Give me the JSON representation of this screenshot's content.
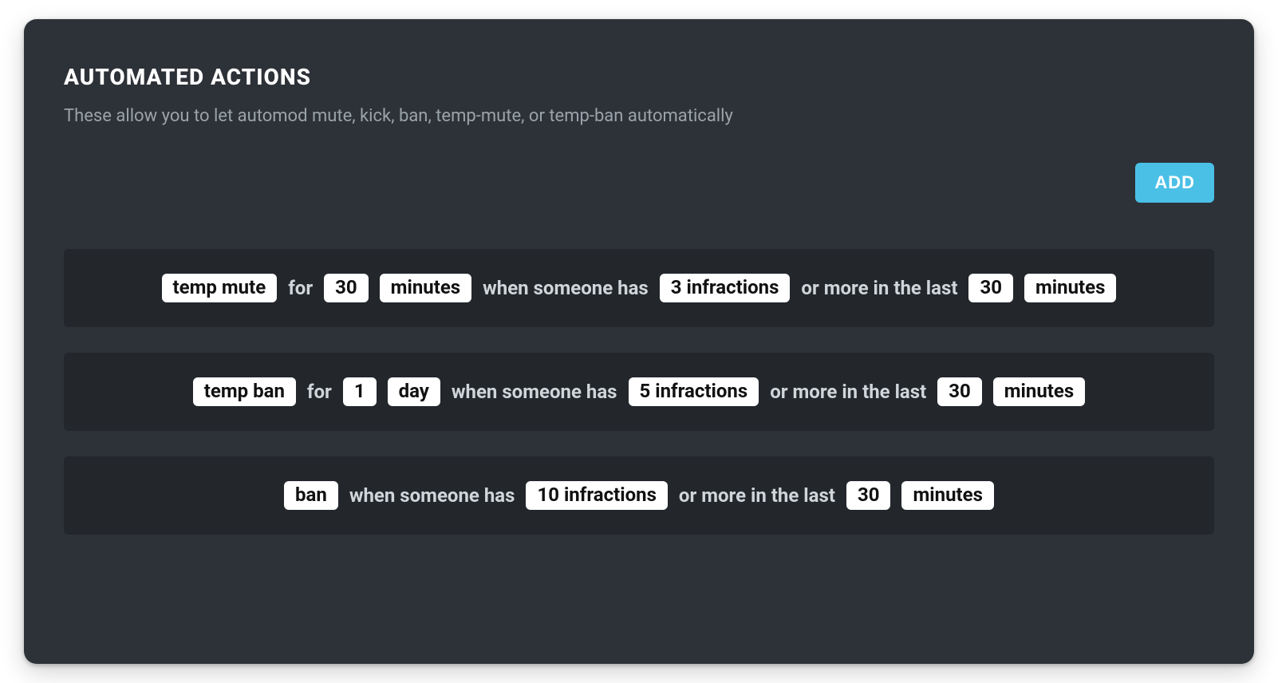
{
  "header": {
    "title": "AUTOMATED ACTIONS",
    "subtitle": "These allow you to let automod mute, kick, ban, temp-mute, or temp-ban automatically",
    "add_label": "ADD"
  },
  "labels": {
    "for": "for",
    "when_someone_has": "when someone has",
    "or_more_in_the_last": "or more in the last"
  },
  "rules": [
    {
      "action": "temp mute",
      "has_duration": true,
      "duration_value": "30",
      "duration_unit": "minutes",
      "infractions": "3 infractions",
      "window_value": "30",
      "window_unit": "minutes"
    },
    {
      "action": "temp ban",
      "has_duration": true,
      "duration_value": "1",
      "duration_unit": "day",
      "infractions": "5 infractions",
      "window_value": "30",
      "window_unit": "minutes"
    },
    {
      "action": "ban",
      "has_duration": false,
      "duration_value": "",
      "duration_unit": "",
      "infractions": "10 infractions",
      "window_value": "30",
      "window_unit": "minutes"
    }
  ]
}
